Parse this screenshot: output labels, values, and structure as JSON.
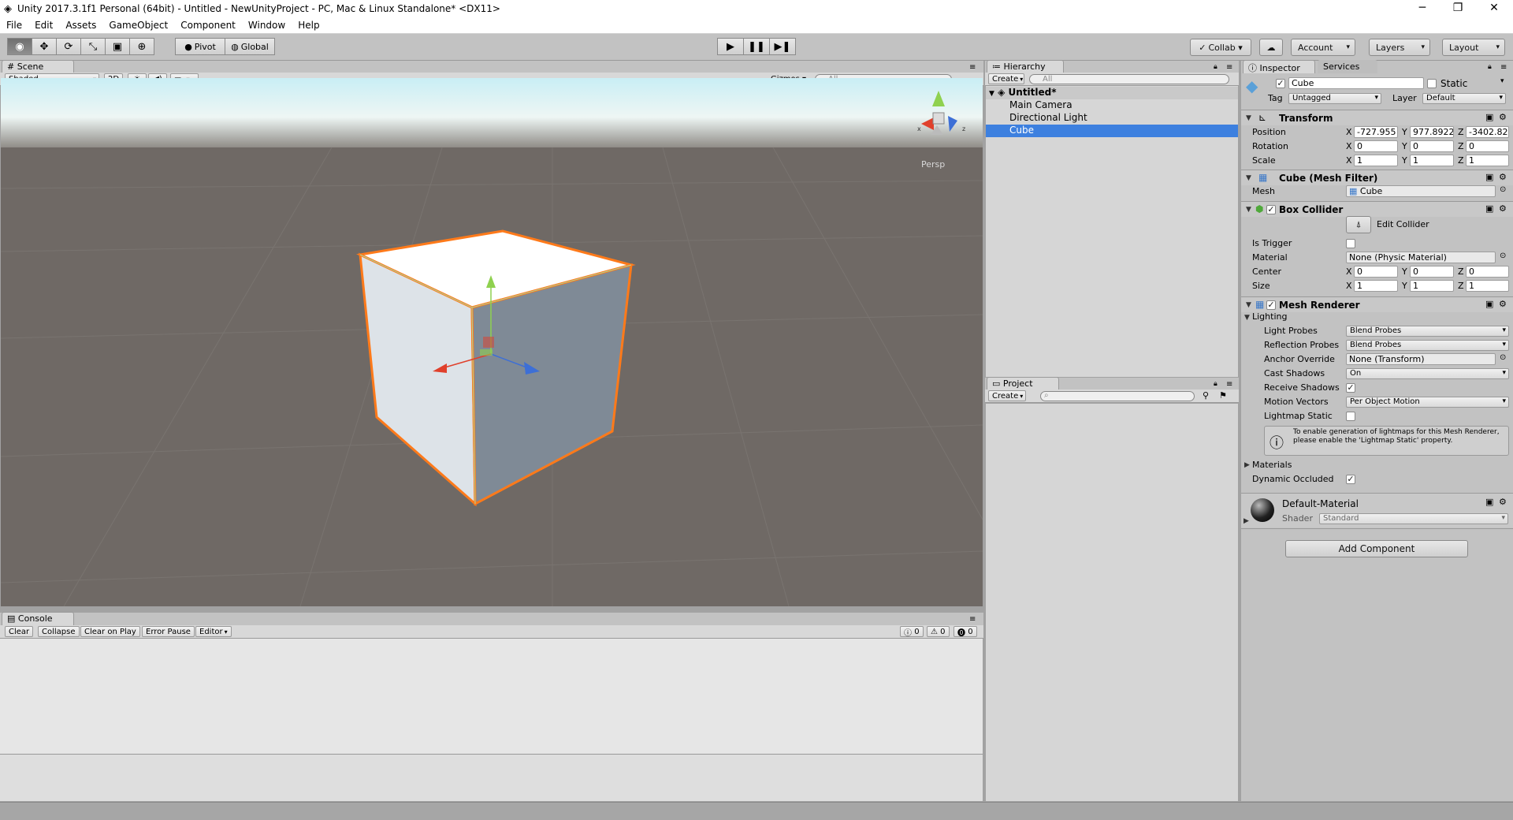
{
  "window": {
    "title": "Unity 2017.3.1f1 Personal (64bit) - Untitled - NewUnityProject - PC, Mac & Linux Standalone* <DX11>",
    "minimize": "─",
    "maximize": "❐",
    "close": "✕"
  },
  "menu": [
    "File",
    "Edit",
    "Assets",
    "GameObject",
    "Component",
    "Window",
    "Help"
  ],
  "toolbar": {
    "pivot": "Pivot",
    "global": "Global",
    "collab": "Collab ▾",
    "account": "Account",
    "layers": "Layers",
    "layout": "Layout"
  },
  "scene": {
    "tab": "Scene",
    "shading": "Shaded",
    "mode2d": "2D",
    "gizmos": "Gizmos ▾",
    "search": "All",
    "persp": "Persp"
  },
  "hierarchy": {
    "tab": "Hierarchy",
    "create": "Create",
    "search": "All",
    "scene_name": "Untitled*",
    "items": [
      "Main Camera",
      "Directional Light",
      "Cube"
    ],
    "selected": "Cube"
  },
  "project": {
    "tab": "Project",
    "create": "Create"
  },
  "console": {
    "tab": "Console",
    "buttons": [
      "Clear",
      "Collapse",
      "Clear on Play",
      "Error Pause",
      "Editor"
    ],
    "count_info": "0",
    "count_warn": "0",
    "count_error": "0"
  },
  "inspector": {
    "tab": "Inspector",
    "tab2": "Services",
    "object_name": "Cube",
    "static_label": "Static",
    "tag_label": "Tag",
    "tag_value": "Untagged",
    "layer_label": "Layer",
    "layer_value": "Default",
    "transform": {
      "title": "Transform",
      "position": {
        "label": "Position",
        "x": "-727.955",
        "y": "977.8922",
        "z": "-3402.82"
      },
      "rotation": {
        "label": "Rotation",
        "x": "0",
        "y": "0",
        "z": "0"
      },
      "scale": {
        "label": "Scale",
        "x": "1",
        "y": "1",
        "z": "1"
      }
    },
    "mesh_filter": {
      "title": "Cube (Mesh Filter)",
      "mesh_label": "Mesh",
      "mesh_value": "Cube"
    },
    "box_collider": {
      "title": "Box Collider",
      "edit": "Edit Collider",
      "is_trigger": "Is Trigger",
      "material_label": "Material",
      "material_value": "None (Physic Material)",
      "center": {
        "label": "Center",
        "x": "0",
        "y": "0",
        "z": "0"
      },
      "size": {
        "label": "Size",
        "x": "1",
        "y": "1",
        "z": "1"
      }
    },
    "mesh_renderer": {
      "title": "Mesh Renderer",
      "lighting": "Lighting",
      "light_probes_label": "Light Probes",
      "light_probes": "Blend Probes",
      "reflection_probes_label": "Reflection Probes",
      "reflection_probes": "Blend Probes",
      "anchor_label": "Anchor Override",
      "anchor": "None (Transform)",
      "cast_label": "Cast Shadows",
      "cast": "On",
      "receive_label": "Receive Shadows",
      "motion_label": "Motion Vectors",
      "motion": "Per Object Motion",
      "lightmap_label": "Lightmap Static",
      "help": "To enable generation of lightmaps for this Mesh Renderer, please enable the 'Lightmap Static' property.",
      "materials": "Materials",
      "dynamic": "Dynamic Occluded"
    },
    "material": {
      "name": "Default-Material",
      "shader_label": "Shader",
      "shader": "Standard"
    },
    "add_component": "Add Component"
  }
}
